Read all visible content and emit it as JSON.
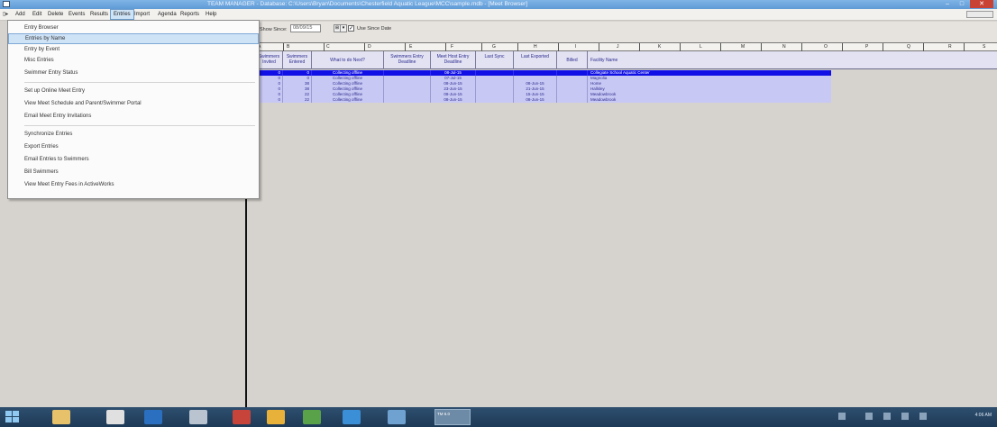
{
  "window": {
    "title": "TEAM MANAGER - Database: C:\\Users\\Bryan\\Documents\\Chesterfield Aquatic League\\MCC\\sample.mdb - [Meet Browser]",
    "controls": {
      "minimize": "–",
      "maximize": "□",
      "close": "✕"
    }
  },
  "menubar": {
    "system_glyph": "▯▸",
    "items": [
      "Add",
      "Edit",
      "Delete",
      "Events",
      "Results",
      "Entries",
      "Import",
      "Agenda",
      "Reports",
      "Help"
    ],
    "active": "Entries"
  },
  "entries_menu": {
    "items": [
      "Entry Browser",
      "Entries by Name",
      "Entry by Event",
      "Misc Entries",
      "Swimmer Entry Status",
      "Set up Online Meet Entry",
      "View Meet Schedule and Parent/Swimmer Portal",
      "Email Meet Entry Invitations",
      "Synchronize Entries",
      "Export Entries",
      "Email Entries to Swimmers",
      "Bill Swimmers",
      "View Meet Entry Fees in ActiveWorks"
    ],
    "highlighted": "Entries by Name"
  },
  "toolbar": {
    "show_since_label": "Show Since:",
    "show_since_value": "08/09/15",
    "use_date_label": "Use Since Date",
    "use_date_checked": "✓",
    "spin_glyph": "⊞",
    "dropdown_glyph": "▾"
  },
  "ruler": {
    "labels": [
      "A",
      "B",
      "C",
      "D",
      "E",
      "F",
      "G",
      "H",
      "I",
      "J",
      "K",
      "L",
      "M",
      "N",
      "O",
      "P",
      "Q",
      "R",
      "S"
    ]
  },
  "grid": {
    "columns": [
      "Swimmers Invited",
      "Swimmers Entered",
      "What to do Next?",
      "Swimmers Entry Deadline",
      "Meet Host Entry Deadline",
      "Last Sync",
      "Last Exported",
      "Billed",
      "Facility Name"
    ],
    "rows": [
      {
        "invited": "0",
        "entered": "0",
        "next": "Collecting offline",
        "swimmer_deadline": "",
        "host_deadline": "08-Jul-15",
        "last_sync": "",
        "last_exported": "",
        "billed": "",
        "facility": "Collegiate School Aquatic Center"
      },
      {
        "invited": "0",
        "entered": "0",
        "next": "Collecting offline",
        "swimmer_deadline": "",
        "host_deadline": "07-Jul-15",
        "last_sync": "",
        "last_exported": "",
        "billed": "",
        "facility": "Magnolia"
      },
      {
        "invited": "0",
        "entered": "38",
        "next": "Collecting offline",
        "swimmer_deadline": "",
        "host_deadline": "08-Jun-15",
        "last_sync": "",
        "last_exported": "08-Jun-15",
        "billed": "",
        "facility": "Home"
      },
      {
        "invited": "0",
        "entered": "38",
        "next": "Collecting offline",
        "swimmer_deadline": "",
        "host_deadline": "23-Jun-15",
        "last_sync": "",
        "last_exported": "21-Jun-15",
        "billed": "",
        "facility": "Hallsley"
      },
      {
        "invited": "0",
        "entered": "22",
        "next": "Collecting offline",
        "swimmer_deadline": "",
        "host_deadline": "08-Jun-15",
        "last_sync": "",
        "last_exported": "15-Jun-15",
        "billed": "",
        "facility": "Meadowbrook"
      },
      {
        "invited": "0",
        "entered": "22",
        "next": "Collecting offline",
        "swimmer_deadline": "",
        "host_deadline": "08-Jun-15",
        "last_sync": "",
        "last_exported": "08-Jun-15",
        "billed": "",
        "facility": "Meadowbrook"
      }
    ]
  },
  "taskbar": {
    "active_app_label": "TM 6.0",
    "clock": "4:06 AM",
    "colors": {
      "bar": "#1d3a57",
      "start": "#8fc8f0"
    }
  },
  "colors": {
    "selected_row": "#1010e6",
    "row": "#c8c8f4",
    "header_text": "#2b2b8f",
    "menu_highlight": "#cfe3f7"
  }
}
